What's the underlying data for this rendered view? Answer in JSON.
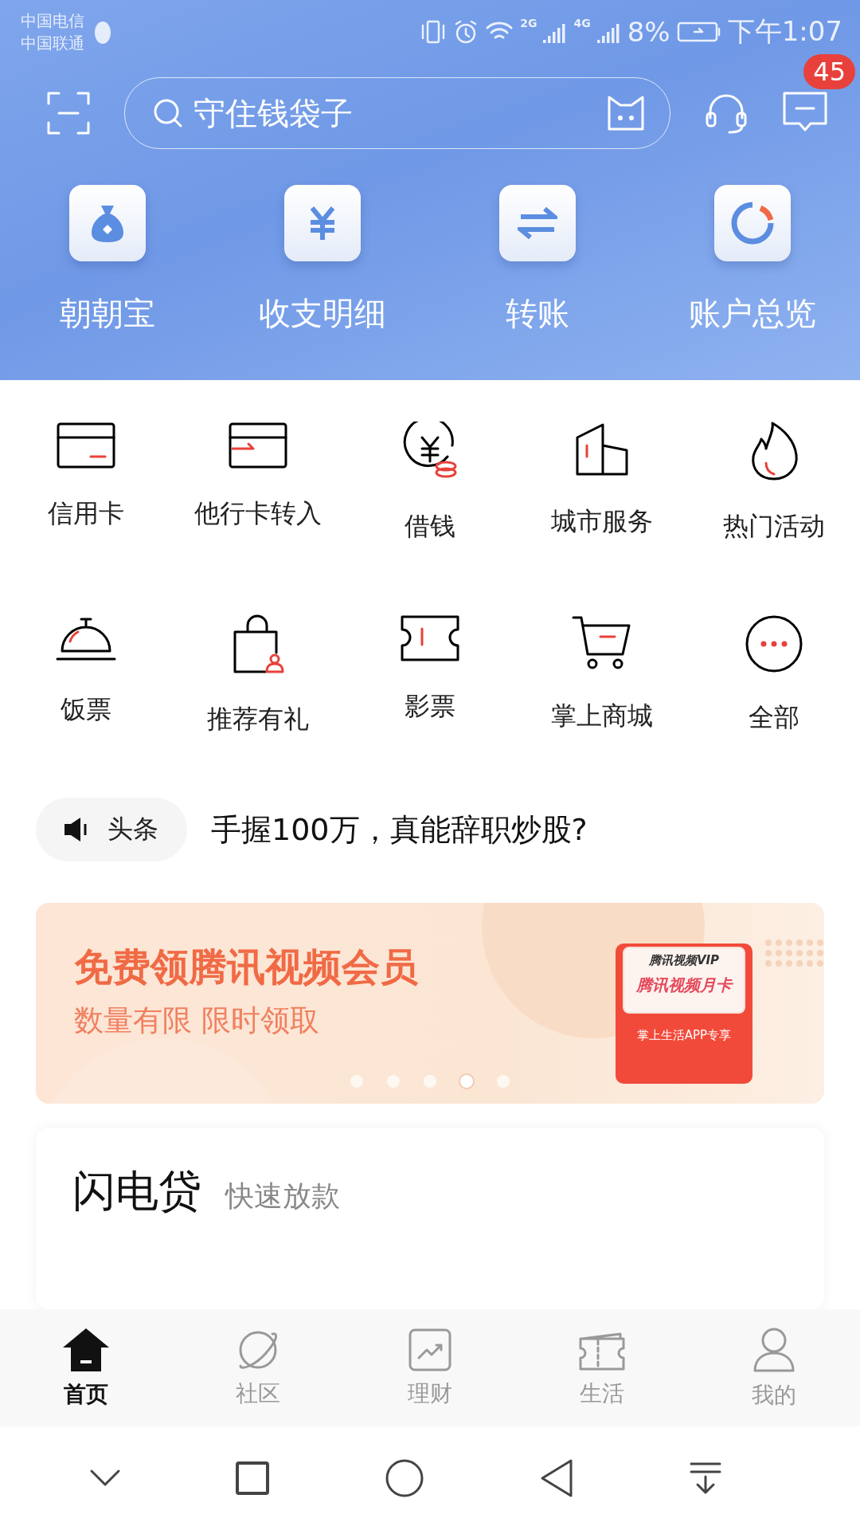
{
  "status_bar": {
    "carriers": [
      "中国电信",
      "中国联通"
    ],
    "network_labels": [
      "2G",
      "4G"
    ],
    "battery": "8%",
    "time": "下午1:07"
  },
  "search": {
    "placeholder": "守住钱袋子"
  },
  "message_badge": "45",
  "quick_actions": [
    {
      "label": "朝朝宝"
    },
    {
      "label": "收支明细"
    },
    {
      "label": "转账"
    },
    {
      "label": "账户总览"
    }
  ],
  "services": [
    {
      "label": "信用卡"
    },
    {
      "label": "他行卡转入"
    },
    {
      "label": "借钱"
    },
    {
      "label": "城市服务"
    },
    {
      "label": "热门活动"
    },
    {
      "label": "饭票"
    },
    {
      "label": "推荐有礼"
    },
    {
      "label": "影票"
    },
    {
      "label": "掌上商城"
    },
    {
      "label": "全部"
    }
  ],
  "headline": {
    "tag": "头条",
    "text": "手握100万，真能辞职炒股?"
  },
  "banner": {
    "title": "免费领腾讯视频会员",
    "subtitle": "数量有限 限时领取",
    "card_brand": "腾讯视频VIP",
    "card_title": "腾讯视频月卡",
    "card_note": "掌上生活APP专享",
    "dots": [
      {
        "selected": false
      },
      {
        "selected": false
      },
      {
        "selected": false
      },
      {
        "selected": true
      },
      {
        "selected": false
      }
    ]
  },
  "loan_card": {
    "title": "闪电贷",
    "subtitle": "快速放款"
  },
  "tab_bar": [
    {
      "label": "首页",
      "selected": true
    },
    {
      "label": "社区",
      "selected": false
    },
    {
      "label": "理财",
      "selected": false
    },
    {
      "label": "生活",
      "selected": false
    },
    {
      "label": "我的",
      "selected": false
    }
  ]
}
